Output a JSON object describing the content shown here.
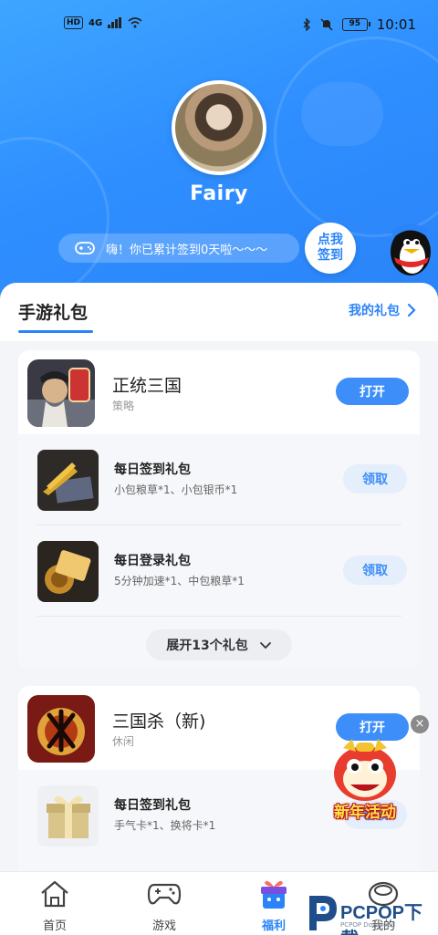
{
  "status_bar": {
    "hd": "HD",
    "network": "4G",
    "battery": "95",
    "time": "10:01"
  },
  "profile": {
    "username": "Fairy",
    "signin_text": "嗨！你已累计签到0天啦～～～",
    "signin_button": "点我\n签到"
  },
  "section": {
    "title": "手游礼包",
    "my_gifts": "我的礼包"
  },
  "games": [
    {
      "name": "正统三国",
      "category": "策略",
      "open_label": "打开",
      "gifts": [
        {
          "name": "每日签到礼包",
          "desc": "小包粮草*1、小包银币*1",
          "action": "领取"
        },
        {
          "name": "每日登录礼包",
          "desc": "5分钟加速*1、中包粮草*1",
          "action": "领取"
        }
      ],
      "expand_label": "展开13个礼包"
    },
    {
      "name": "三国杀（新)",
      "category": "休闲",
      "open_label": "打开",
      "gifts": [
        {
          "name": "每日签到礼包",
          "desc": "手气卡*1、换将卡*1",
          "action": "领取"
        }
      ]
    }
  ],
  "promo": {
    "label": "新年活动",
    "close": "×"
  },
  "bottom_nav": [
    {
      "label": "首页",
      "icon": "home-icon",
      "active": false
    },
    {
      "label": "游戏",
      "icon": "gamepad-icon",
      "active": false
    },
    {
      "label": "福利",
      "icon": "gift-box-icon",
      "active": true
    },
    {
      "label": "我的",
      "icon": "profile-icon",
      "active": false
    }
  ],
  "watermark": {
    "text": "PCPOP下载",
    "sub": "PCPOP Download"
  },
  "colors": {
    "accent": "#2a83f8",
    "header_gradient_start": "#3ea6ff",
    "claim_bg": "#e5eefb"
  }
}
